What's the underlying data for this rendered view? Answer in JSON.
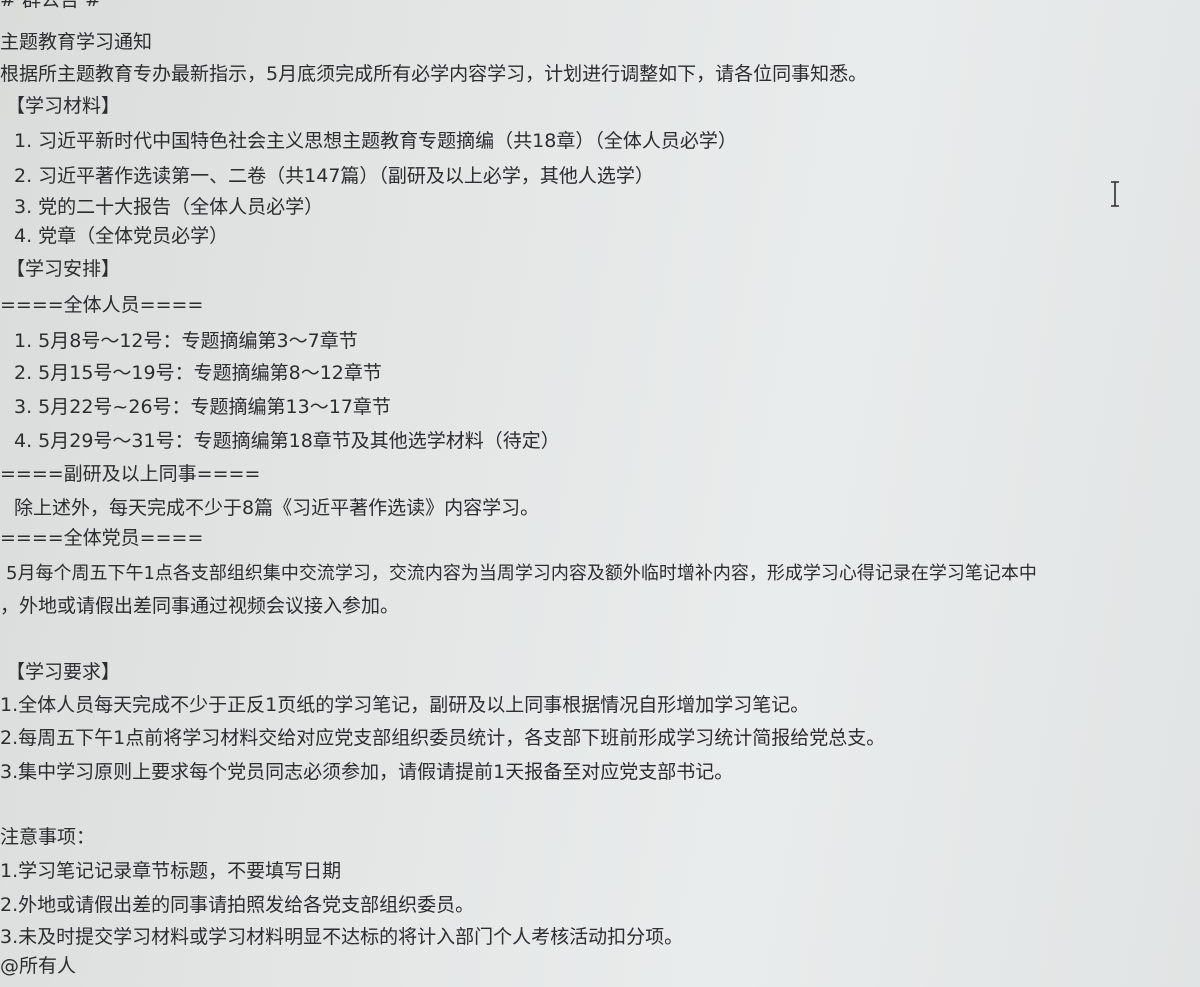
{
  "notice": {
    "header": "# 群公告 #",
    "title": "主题教育学习通知",
    "intro": "根据所主题教育专办最新指示，5月底须完成所有必学内容学习，计划进行调整如下，请各位同事知悉。",
    "materials": {
      "heading": "【学习材料】",
      "items": [
        "1. 习近平新时代中国特色社会主义思想主题教育专题摘编（共18章）（全体人员必学）",
        "2. 习近平著作选读第一、二卷（共147篇）（副研及以上必学，其他人选学）",
        "3. 党的二十大报告（全体人员必学）",
        "4. 党章（全体党员必学）"
      ]
    },
    "schedule": {
      "heading": "【学习安排】",
      "all_staff_heading": "====全体人员====",
      "all_staff_items": [
        "1. 5月8号～12号：专题摘编第3～7章节",
        "2. 5月15号～19号：专题摘编第8～12章节",
        "3. 5月22号~26号：专题摘编第13～17章节",
        "4. 5月29号～31号：专题摘编第18章节及其他选学材料（待定）"
      ],
      "senior_heading": "====副研及以上同事====",
      "senior_text": "除上述外，每天完成不少于8篇《习近平著作选读》内容学习。",
      "members_heading": "====全体党员====",
      "members_text_1": "5月每个周五下午1点各支部组织集中交流学习，交流内容为当周学习内容及额外临时增补内容，形成学习心得记录在学习笔记本中",
      "members_text_2": "，外地或请假出差同事通过视频会议接入参加。"
    },
    "requirements": {
      "heading": "【学习要求】",
      "items": [
        "1.全体人员每天完成不少于正反1页纸的学习笔记，副研及以上同事根据情况自形增加学习笔记。",
        "2.每周五下午1点前将学习材料交给对应党支部组织委员统计，各支部下班前形成学习统计简报给党总支。",
        "3.集中学习原则上要求每个党员同志必须参加，请假请提前1天报备至对应党支部书记。"
      ]
    },
    "notes": {
      "heading": "注意事项：",
      "items": [
        "1.学习笔记记录章节标题，不要填写日期",
        "2.外地或请假出差的同事请拍照发给各党支部组织委员。",
        "3.未及时提交学习材料或学习材料明显不达标的将计入部门个人考核活动扣分项。"
      ]
    },
    "mention": "@所有人"
  },
  "colors": {
    "text": "#2b2d2f",
    "background": "#e6e9e8"
  },
  "icons": {
    "cursor": "text-cursor-icon"
  }
}
